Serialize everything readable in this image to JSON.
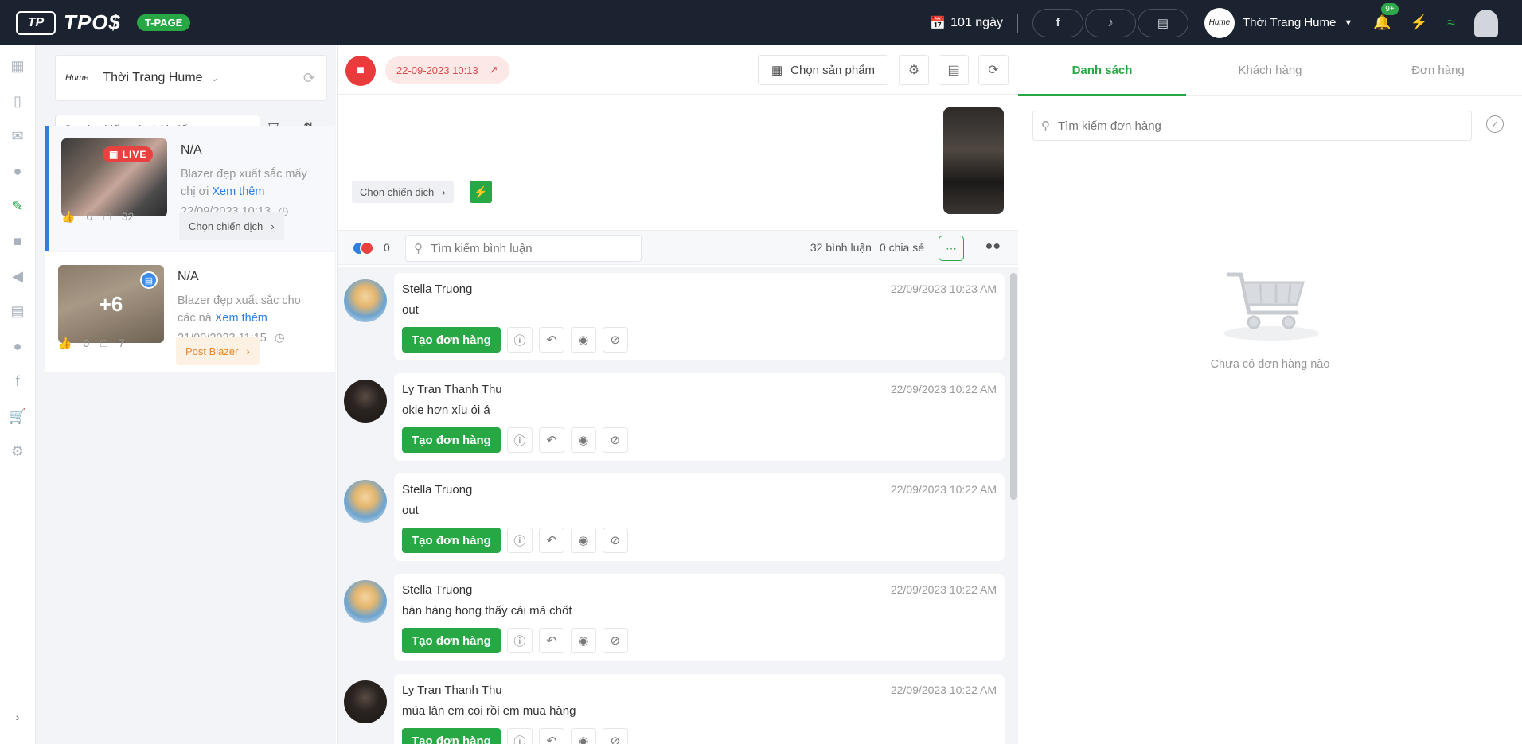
{
  "app": {
    "logo_mark": "TP",
    "logo_text": "TPO$",
    "badge": "T-PAGE"
  },
  "topbar": {
    "days_label": "101 ngày",
    "shop_avatar_text": "Hume",
    "shop_name": "Thời Trang Hume",
    "notification_count": "9+"
  },
  "page_selector": {
    "logo": "Hume",
    "name": "Thời Trang Hume"
  },
  "post_search": {
    "placeholder": "Tìm kiếm tên bài viết"
  },
  "posts": [
    {
      "title": "N/A",
      "badge": "LIVE",
      "desc": "Blazer đẹp xuất sắc mấy chị ơi",
      "more": "Xem thêm",
      "time": "22/09/2023 10:13",
      "likes": "0",
      "comments": "32",
      "chip": "Chọn chiến dịch"
    },
    {
      "title": "N/A",
      "extra_images": "+6",
      "desc": "Blazer đẹp xuất sắc cho các nà",
      "more": "Xem thêm",
      "time": "21/09/2023 11:15",
      "likes": "0",
      "comments": "7",
      "chip": "Post Blazer"
    }
  ],
  "live": {
    "date": "22-09-2023 10:13",
    "choose_product": "Chọn sản phẩm",
    "campaign": "Chọn chiến dịch",
    "like_count": "0",
    "comment_search_placeholder": "Tìm kiếm bình luận",
    "comment_count": "32 bình luận",
    "share_count": "0 chia sẻ"
  },
  "comments": [
    {
      "name": "Stella Truong",
      "time": "22/09/2023 10:23 AM",
      "text": "out",
      "avatar": "blonde",
      "action": "Tạo đơn hàng"
    },
    {
      "name": "Ly Tran Thanh Thu",
      "time": "22/09/2023 10:22 AM",
      "text": "okie hơn xíu ói á",
      "avatar": "dark",
      "action": "Tạo đơn hàng"
    },
    {
      "name": "Stella Truong",
      "time": "22/09/2023 10:22 AM",
      "text": "out",
      "avatar": "blonde",
      "action": "Tạo đơn hàng"
    },
    {
      "name": "Stella Truong",
      "time": "22/09/2023 10:22 AM",
      "text": "bán hàng hong thấy cái mã chốt",
      "avatar": "blonde",
      "action": "Tạo đơn hàng"
    },
    {
      "name": "Ly Tran Thanh Thu",
      "time": "22/09/2023 10:22 AM",
      "text": "múa lân em coi rồi em mua hàng",
      "avatar": "dark",
      "action": "Tạo đơn hàng"
    }
  ],
  "orders": {
    "tabs": [
      "Danh sách",
      "Khách hàng",
      "Đơn hàng"
    ],
    "search_placeholder": "Tìm kiếm đơn hàng",
    "empty_text": "Chưa có đơn hàng nào"
  },
  "colors": {
    "accent": "#28a745",
    "topbar": "#1b2330",
    "live_red": "#e93b3b",
    "link_blue": "#2f7fe0"
  }
}
